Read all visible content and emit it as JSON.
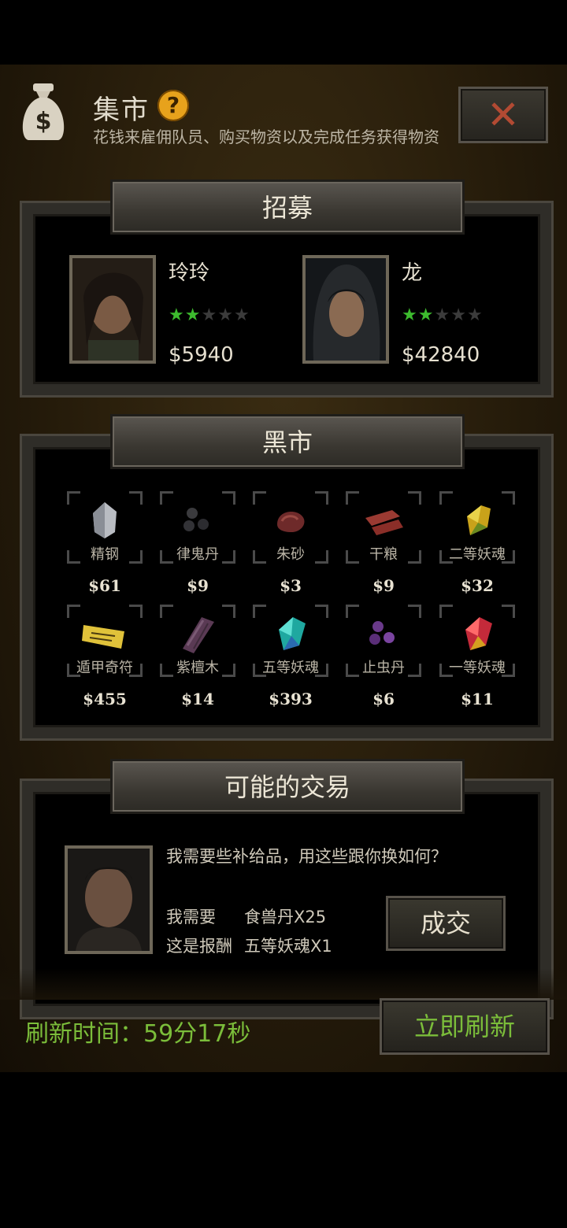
{
  "header": {
    "title": "集市",
    "help_label": "?",
    "subtitle": "花钱来雇佣队员、购买物资以及完成任务获得物资",
    "close_label": "✕"
  },
  "recruit": {
    "title": "招募",
    "members": [
      {
        "name": "玲玲",
        "stars_filled": 2,
        "stars_total": 5,
        "price": "$5940"
      },
      {
        "name": "龙",
        "stars_filled": 2,
        "stars_total": 5,
        "price": "$42840"
      }
    ]
  },
  "black_market": {
    "title": "黑市",
    "items": [
      {
        "name": "精钢",
        "price": "$61",
        "icon": "steel-ore-icon"
      },
      {
        "name": "律鬼丹",
        "price": "$9",
        "icon": "black-pills-icon"
      },
      {
        "name": "朱砂",
        "price": "$3",
        "icon": "cinnabar-icon"
      },
      {
        "name": "干粮",
        "price": "$9",
        "icon": "jerky-icon"
      },
      {
        "name": "二等妖魂",
        "price": "$32",
        "icon": "yellow-crystal-icon"
      },
      {
        "name": "遁甲奇符",
        "price": "$455",
        "icon": "talisman-icon"
      },
      {
        "name": "紫檀木",
        "price": "$14",
        "icon": "sandalwood-icon"
      },
      {
        "name": "五等妖魂",
        "price": "$393",
        "icon": "cyan-crystal-icon"
      },
      {
        "name": "止虫丹",
        "price": "$6",
        "icon": "purple-pills-icon"
      },
      {
        "name": "一等妖魂",
        "price": "$11",
        "icon": "red-crystal-icon"
      }
    ]
  },
  "trade": {
    "title": "可能的交易",
    "message": "我需要些补给品，用这些跟你换如何？",
    "need_label": "我需要",
    "need_item": "食兽丹X25",
    "reward_label": "这是报酬",
    "reward_item": "五等妖魂X1",
    "deal_label": "成交"
  },
  "footer": {
    "refresh_time": "刷新时间：59分17秒",
    "refresh_now_label": "立即刷新"
  },
  "colors": {
    "accent_green": "#7bbd3a",
    "star_green": "#3dbb2e",
    "help_orange": "#e7a21c",
    "close_red": "#b24a33"
  }
}
